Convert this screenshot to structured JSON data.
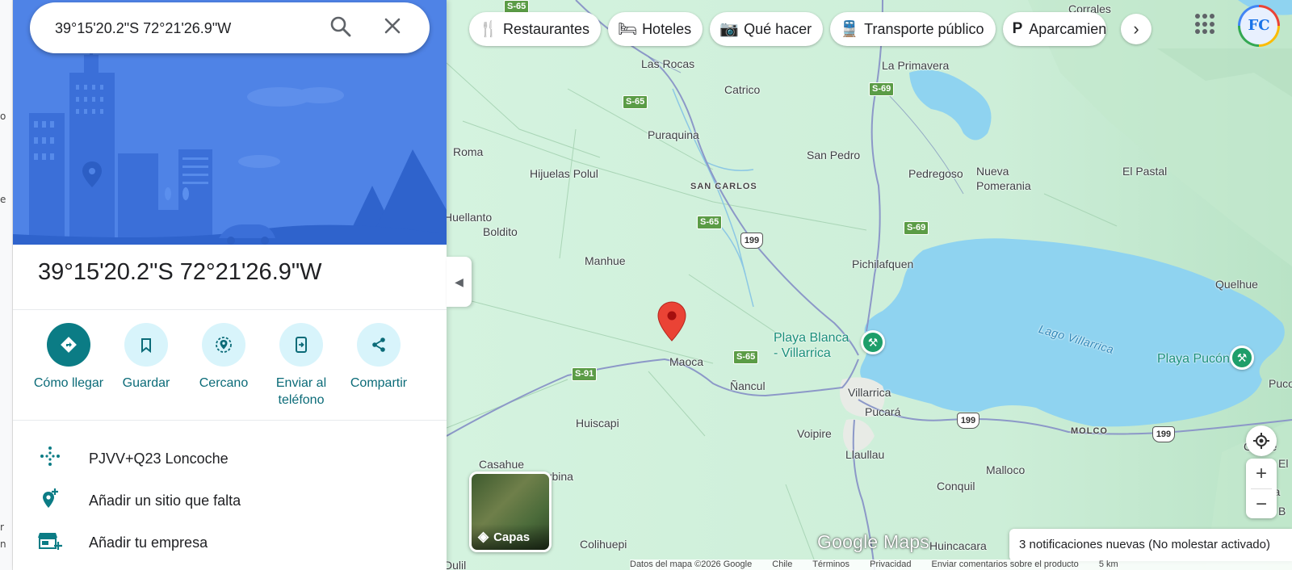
{
  "search": {
    "query": "39°15'20.2\"S 72°21'26.9\"W"
  },
  "place": {
    "title": "39°15'20.2\"S 72°21'26.9\"W"
  },
  "actions": [
    {
      "label": "Cómo llegar",
      "icon": "directions-icon"
    },
    {
      "label": "Guardar",
      "icon": "bookmark-icon"
    },
    {
      "label": "Cercano",
      "icon": "nearby-icon"
    },
    {
      "label": "Enviar al teléfono",
      "icon": "send-to-phone-icon"
    },
    {
      "label": "Compartir",
      "icon": "share-icon"
    }
  ],
  "info": [
    {
      "text": "PJVV+Q23 Loncoche",
      "icon": "plus-code-icon"
    },
    {
      "text": "Añadir un sitio que falta",
      "icon": "add-place-icon"
    },
    {
      "text": "Añadir tu empresa",
      "icon": "add-business-icon"
    }
  ],
  "chips": [
    {
      "label": "Restaurantes",
      "icon": "restaurant-icon"
    },
    {
      "label": "Hoteles",
      "icon": "hotel-icon"
    },
    {
      "label": "Qué hacer",
      "icon": "camera-icon"
    },
    {
      "label": "Transporte público",
      "icon": "transit-icon"
    },
    {
      "label": "Aparcamiento",
      "icon": "parking-icon"
    }
  ],
  "layers_label": "Capas",
  "brand": {
    "logo": "Google Maps",
    "avatar_text": "FC"
  },
  "toast": "3 notificaciones nuevas (No molestar activado)",
  "footer": [
    "Datos del mapa ©2026 Google",
    "Chile",
    "Términos",
    "Privacidad",
    "Enviar comentarios sobre el producto",
    "5 km"
  ],
  "map_labels": {
    "corrales": "Corrales",
    "las_rocas": "Las Rocas",
    "la_primavera": "La Primavera",
    "catrico": "Catrico",
    "puraquina": "Puraquina",
    "roma": "Roma",
    "san_pedro": "San Pedro",
    "hijuelas": "Hijuelas Polul",
    "san_carlos": "SAN CARLOS",
    "pedregoso": "Pedregoso",
    "nueva_pomerania": "Nueva\nPomerania",
    "el_pastal": "El Pastal",
    "huellanto": "Huellanto",
    "boldito": "Boldito",
    "manhue": "Manhue",
    "pichilafquen": "Pichilafquen",
    "quelhue": "Quelhue",
    "playa_blanca": "Playa Blanca\n- Villarrica",
    "lago": "Lago Villarrica",
    "playa_pucon": "Playa Pucón",
    "maoca": "Maoca",
    "nancul": "Ñancul",
    "villarrica": "Villarrica",
    "pucara": "Pucará",
    "pucon": "Pucon",
    "molco": "MOLCO",
    "huiscapi": "Huiscapi",
    "voipire": "Voipire",
    "llaullau": "Llaullau",
    "cande": "Cande",
    "casahue": "Casahue",
    "urbina": "urbina",
    "malloco": "Malloco",
    "conquil": "Conquil",
    "colihuepi": "Colihuepi",
    "huincacara": "Huincacara",
    "za": "Za",
    "el_cut": "El",
    "b_cut": "B",
    "dulil": "Dulil"
  },
  "roads": {
    "s65": "S-65",
    "s69": "S-69",
    "s91": "S-91",
    "r199": "199"
  },
  "left_edge": [
    "o",
    "e",
    "r",
    "n"
  ]
}
